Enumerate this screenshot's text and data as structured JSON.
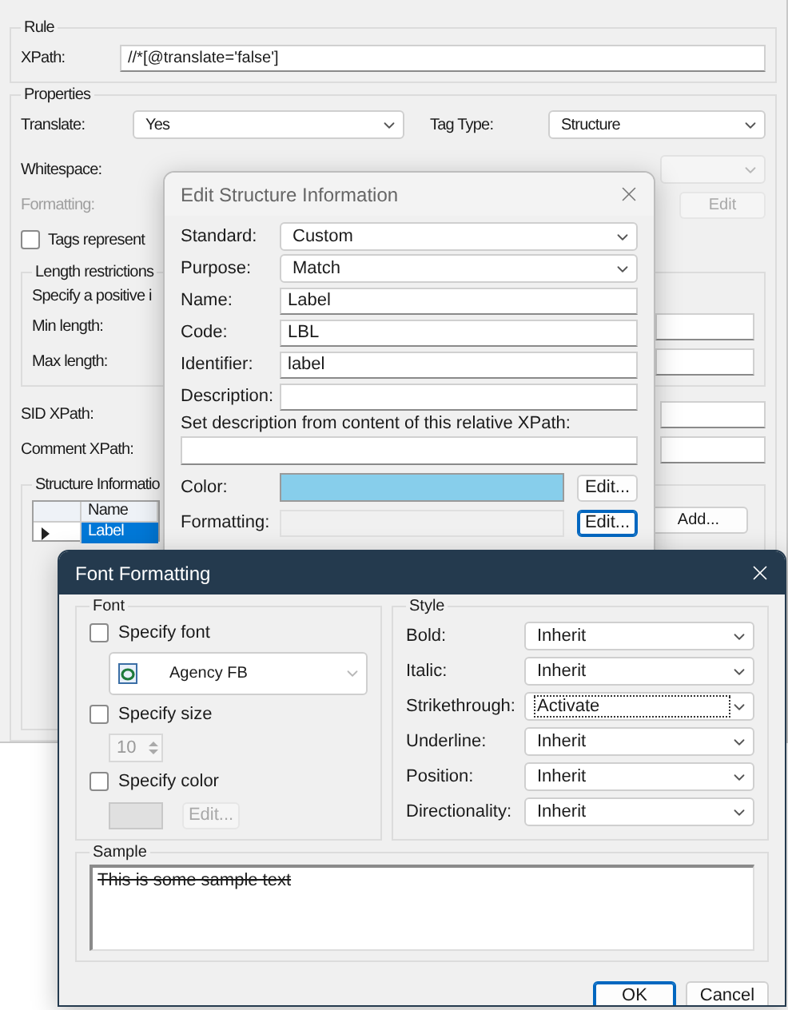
{
  "edit_rule": {
    "rule": {
      "title": "Rule",
      "xpath_label": "XPath:",
      "xpath_value": "//*[@translate='false']"
    },
    "properties": {
      "title": "Properties",
      "translate_label": "Translate:",
      "translate_value": "Yes",
      "tag_type_label": "Tag Type:",
      "tag_type_value": "Structure",
      "whitespace_label": "Whitespace:",
      "formatting_label": "Formatting:",
      "formatting_disabled": true,
      "formatting_button": "Edit",
      "tags_checkbox": {
        "label": "Tags represent",
        "checked": false
      },
      "length": {
        "title": "Length restrictions",
        "hint": "Specify a positive i",
        "min_label": "Min length:",
        "max_label": "Max length:"
      },
      "sid_label": "SID XPath:",
      "comment_label": "Comment XPath:",
      "structure": {
        "title": "Structure Informatio",
        "columns": [
          "Name"
        ],
        "rows": [
          {
            "name": "Label",
            "selected": true
          }
        ],
        "add_button": "Add..."
      }
    }
  },
  "structure_dialog": {
    "title": "Edit Structure Information",
    "fields": [
      {
        "kind": "select",
        "label": "Standard:",
        "value": "Custom"
      },
      {
        "kind": "select",
        "label": "Purpose:",
        "value": "Match"
      },
      {
        "kind": "text",
        "label": "Name:",
        "value": "Label"
      },
      {
        "kind": "text",
        "label": "Code:",
        "value": "LBL"
      },
      {
        "kind": "text",
        "label": "Identifier:",
        "value": "label"
      },
      {
        "kind": "text",
        "label": "Description:"
      }
    ],
    "xpath_label": "Set description from content of this relative XPath:",
    "color": {
      "label": "Color:",
      "color": "#87ceeb",
      "button": "Edit..."
    },
    "formatting": {
      "label": "Formatting:",
      "button": "Edit...",
      "focused": true
    }
  },
  "font_dialog": {
    "title": "Font Formatting",
    "font": {
      "title": "Font",
      "specify_font": {
        "label": "Specify font",
        "checked": false
      },
      "font_value": "Agency FB",
      "specify_size": {
        "label": "Specify size",
        "checked": false
      },
      "size_value": "10",
      "specify_color": {
        "label": "Specify color",
        "checked": false
      },
      "color_button": "Edit..."
    },
    "style": {
      "title": "Style",
      "rows": [
        {
          "label": "Bold:",
          "value": "Inherit",
          "focused": false
        },
        {
          "label": "Italic:",
          "value": "Inherit",
          "focused": false
        },
        {
          "label": "Strikethrough:",
          "value": "Activate",
          "focused": true
        },
        {
          "label": "Underline:",
          "value": "Inherit",
          "focused": false
        },
        {
          "label": "Position:",
          "value": "Inherit",
          "focused": false
        },
        {
          "label": "Directionality:",
          "value": "Inherit",
          "focused": false
        }
      ]
    },
    "sample": {
      "title": "Sample",
      "text": "This is some sample text",
      "strikethrough": true
    },
    "buttons": [
      {
        "label": "OK",
        "default": true
      },
      {
        "label": "Cancel",
        "default": false
      }
    ]
  }
}
